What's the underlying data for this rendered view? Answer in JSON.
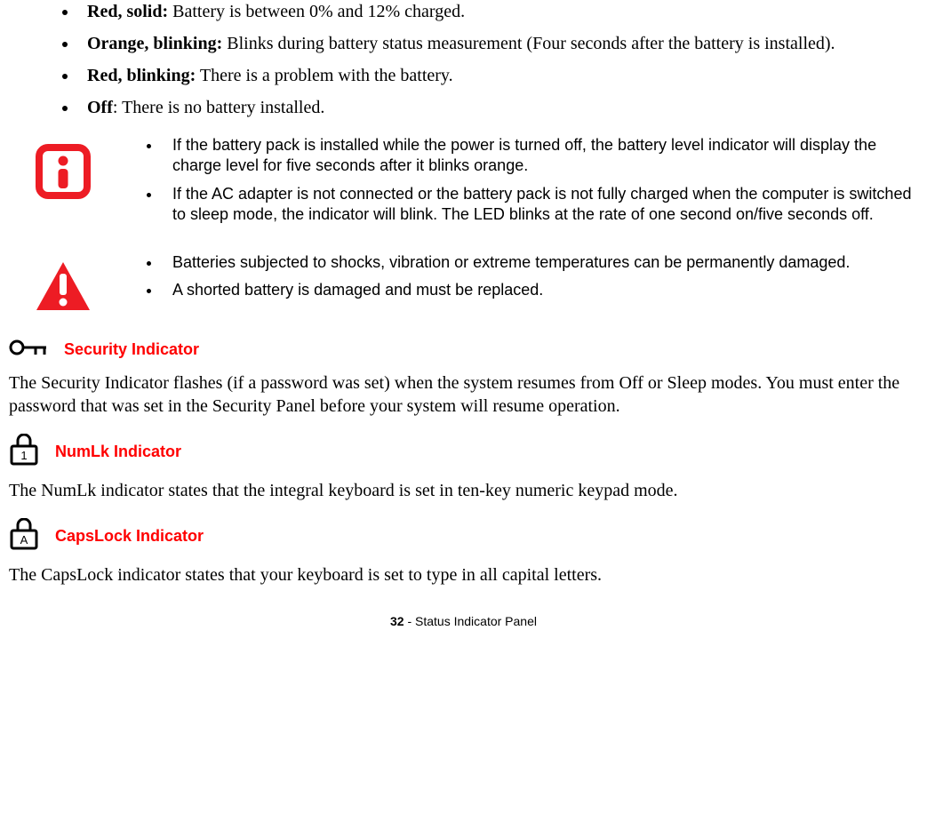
{
  "bullets": [
    {
      "term": "Red, solid:",
      "desc": " Battery is between 0% and 12% charged."
    },
    {
      "term": "Orange, blinking:",
      "desc": " Blinks during battery status measurement (Four seconds after the battery is installed)."
    },
    {
      "term": "Red, blinking:",
      "desc": " There is a problem with the battery."
    },
    {
      "term": "Off",
      "desc": ": There is no battery installed."
    }
  ],
  "info_callout": [
    " If the battery pack is installed while the power is turned off, the battery level indicator will display the charge level for five seconds after it blinks orange.",
    "If the AC adapter is not connected or the battery pack is not fully charged when the computer is switched to sleep mode, the indicator will blink. The LED blinks at the rate of one second on/five seconds off."
  ],
  "warning_callout": [
    "Batteries subjected to shocks, vibration or extreme temperatures can be permanently damaged.",
    "A shorted battery is damaged and must be replaced."
  ],
  "sections": {
    "security": {
      "title": "Security Indicator",
      "body": "The Security Indicator flashes (if a password was set) when the system resumes from Off or Sleep modes. You must enter the password that was set in the Security Panel before your system will resume operation."
    },
    "numlk": {
      "title": "NumLk Indicator",
      "body": "The NumLk indicator states that the integral keyboard is set in ten-key numeric keypad mode."
    },
    "capslock": {
      "title": "CapsLock Indicator",
      "body": "The CapsLock indicator states that your keyboard is set to type in all capital letters."
    }
  },
  "footer": {
    "page": "32",
    "sep": " - ",
    "title": "Status Indicator Panel"
  }
}
